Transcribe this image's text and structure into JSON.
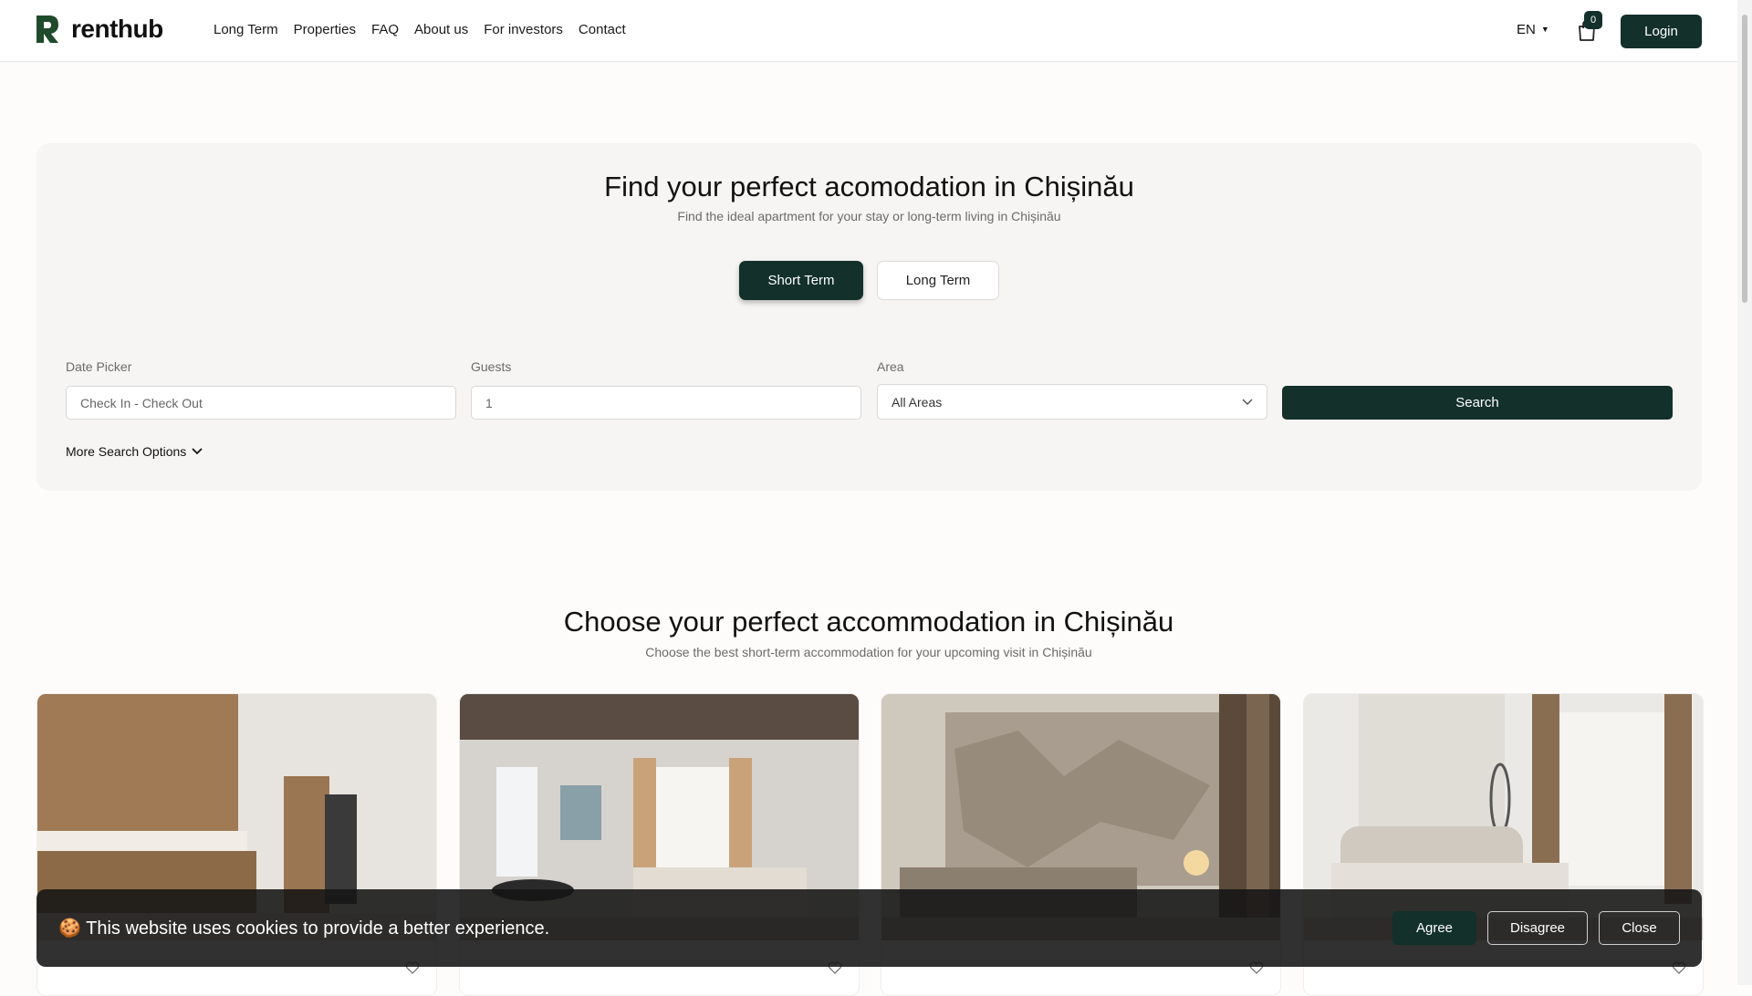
{
  "header": {
    "logo_text": "renthub",
    "nav": [
      "Long Term",
      "Properties",
      "FAQ",
      "About us",
      "For investors",
      "Contact"
    ],
    "language": "EN",
    "cart_count": "0",
    "login_label": "Login"
  },
  "hero": {
    "title": "Find your perfect acomodation in Chișinău",
    "subtitle": "Find the ideal apartment for your stay or long-term living in Chișinău",
    "tabs": {
      "short": "Short Term",
      "long": "Long Term"
    },
    "date_label": "Date Picker",
    "date_placeholder": "Check In - Check Out",
    "guests_label": "Guests",
    "guests_value": "1",
    "area_label": "Area",
    "area_value": "All Areas",
    "search_label": "Search",
    "more_options": "More Search Options"
  },
  "section": {
    "title": "Choose your perfect accommodation in Chișinău",
    "subtitle": "Choose the best short-term accommodation for your upcoming visit in Chișinău"
  },
  "cookie": {
    "text": "🍪 This website uses cookies to provide a better experience.",
    "agree": "Agree",
    "disagree": "Disagree",
    "close": "Close"
  },
  "colors": {
    "brand_dark": "#13302b",
    "logo_green": "#1f4a2c"
  }
}
